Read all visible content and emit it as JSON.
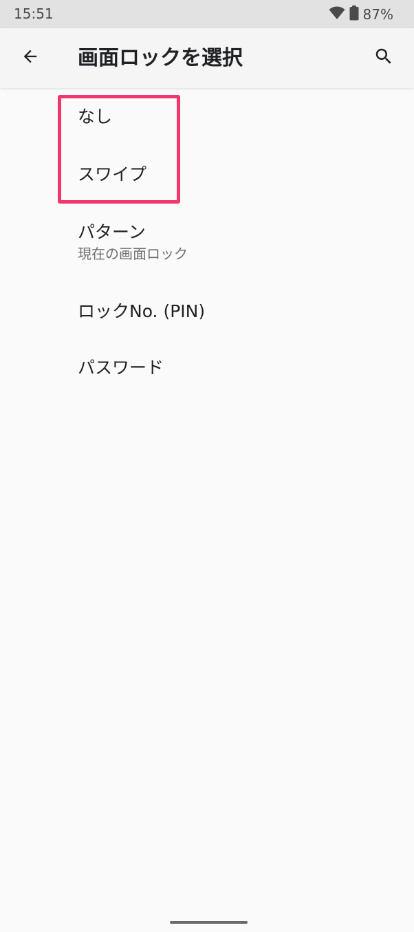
{
  "status_bar": {
    "time": "15:51",
    "battery": "87%",
    "icons": [
      "wifi-icon",
      "battery-icon"
    ]
  },
  "app_bar": {
    "title": "画面ロックを選択",
    "back_icon": "arrow-back-icon",
    "search_icon": "search-icon"
  },
  "options": [
    {
      "label": "なし",
      "subtitle": ""
    },
    {
      "label": "スワイプ",
      "subtitle": ""
    },
    {
      "label": "パターン",
      "subtitle": "現在の画面ロック"
    },
    {
      "label": "ロックNo. (PIN)",
      "subtitle": ""
    },
    {
      "label": "パスワード",
      "subtitle": ""
    }
  ],
  "colors": {
    "highlight": "#f0386f",
    "background": "#fafafa",
    "status_bar": "#e2e2e2"
  }
}
